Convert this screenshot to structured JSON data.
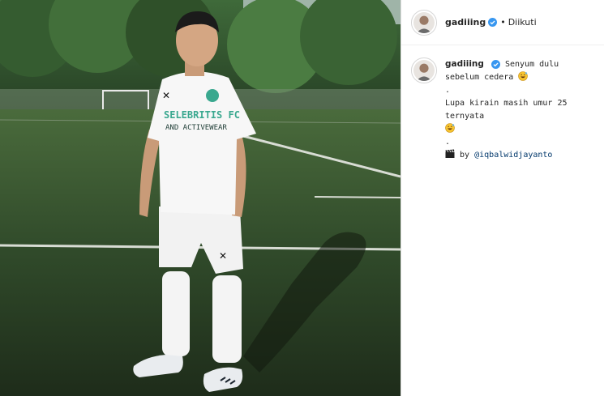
{
  "header": {
    "username": "gadiiing",
    "verified_icon": "verified-badge-icon",
    "separator": "•",
    "follow_state": "Diikuti"
  },
  "caption": {
    "username": "gadiiing",
    "line1": "Senyum dulu sebelum cedera",
    "line1_emoji": "grinning-sweat-emoji",
    "dot1": ".",
    "line2": "Lupa kirain masih umur 25 ternyata",
    "line2_emoji": "grinning-sweat-emoji",
    "dot2": ".",
    "credit_icon": "clapperboard-icon",
    "credit_prefix": "by",
    "credit_mention": "@iqbalwidjayanto"
  },
  "photo": {
    "subject": "football-player-photo",
    "jersey_text_line1": "SELEBRITIS FC",
    "jersey_text_line2": "AND ACTIVEWEAR"
  },
  "colors": {
    "verified_blue": "#3897f0",
    "mention_blue": "#00376b",
    "pitch_green": "#2d4426"
  }
}
